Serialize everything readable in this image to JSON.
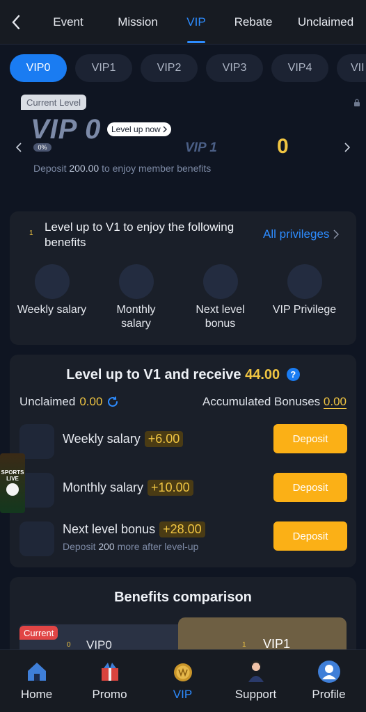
{
  "topnav": {
    "tabs": [
      {
        "label": "Event"
      },
      {
        "label": "Mission"
      },
      {
        "label": "VIP"
      },
      {
        "label": "Rebate"
      },
      {
        "label": "Unclaimed"
      }
    ],
    "active_tab": "VIP"
  },
  "vip_pills": [
    "VIP0",
    "VIP1",
    "VIP2",
    "VIP3",
    "VIP4",
    "VII"
  ],
  "level": {
    "current_tag": "Current Level",
    "current_vip": "VIP 0",
    "level_up_chip": "Level up now",
    "progress_percent": "0%",
    "next_vip": "VIP 1",
    "next_value": "0",
    "hint_prefix": "Deposit",
    "hint_amount": "200.00",
    "hint_suffix": "to enjoy member benefits"
  },
  "privileges": {
    "index": "1",
    "heading": "Level up to V1 to enjoy the following benefits",
    "all_link": "All privileges",
    "items": [
      {
        "label": "Weekly salary"
      },
      {
        "label": "Monthly salary"
      },
      {
        "label": "Next level bonus"
      },
      {
        "label": "VIP Privilege"
      }
    ]
  },
  "receive": {
    "title_prefix": "Level up to V1 and receive",
    "title_amount": "44.00",
    "help": "?",
    "unclaimed_label": "Unclaimed",
    "unclaimed_value": "0.00",
    "accumulated_label": "Accumulated Bonuses",
    "accumulated_value": "0.00",
    "rows": [
      {
        "label": "Weekly salary",
        "amount": "+6.00",
        "button": "Deposit"
      },
      {
        "label": "Monthly salary",
        "amount": "+10.00",
        "button": "Deposit"
      },
      {
        "label": "Next level bonus",
        "amount": "+28.00",
        "button": "Deposit",
        "sub_prefix": "Deposit",
        "sub_amount": "200",
        "sub_suffix": "more after level-up"
      }
    ]
  },
  "side_promo": {
    "line1": "SPORTS",
    "line2": "LIVE"
  },
  "comparison": {
    "title": "Benefits comparison",
    "current_tag": "Current",
    "left_index": "0",
    "left_label": "VIP0",
    "right_index": "1",
    "right_label": "VIP1"
  },
  "bottomnav": {
    "items": [
      {
        "label": "Home"
      },
      {
        "label": "Promo"
      },
      {
        "label": "VIP"
      },
      {
        "label": "Support"
      },
      {
        "label": "Profile"
      }
    ],
    "active": "VIP"
  },
  "colors": {
    "accent_blue": "#1a7cf2",
    "gold": "#f0c542",
    "deposit_orange": "#fbb016"
  }
}
